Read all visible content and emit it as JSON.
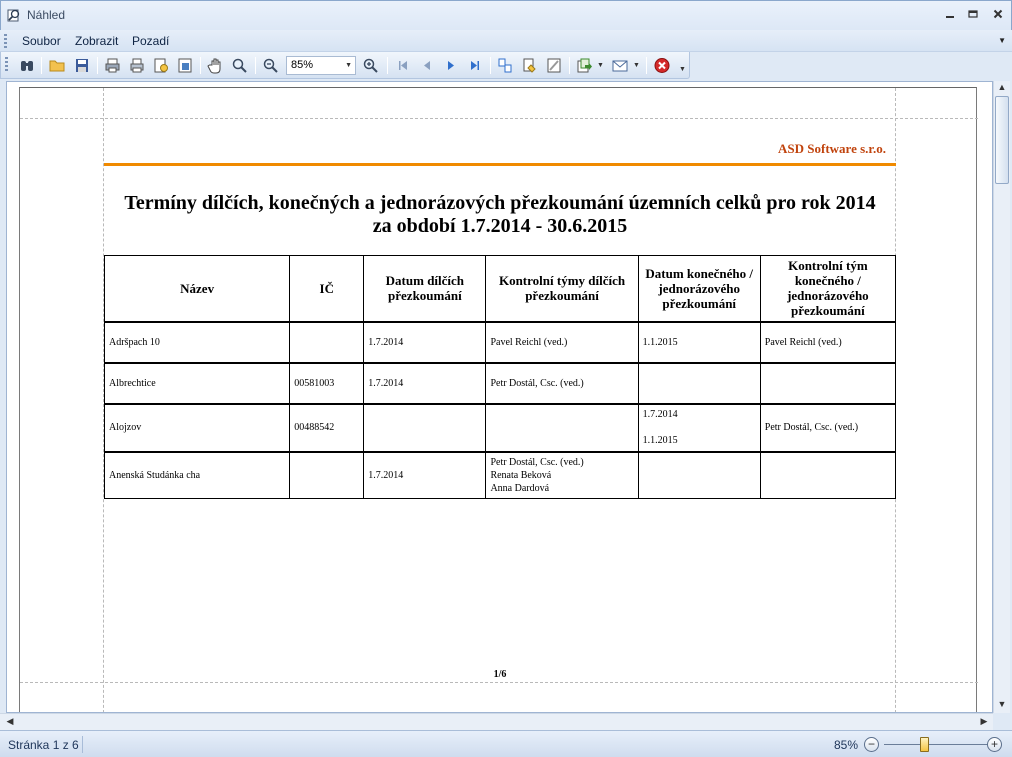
{
  "window": {
    "title": "Náhled"
  },
  "menu": {
    "items": [
      "Soubor",
      "Zobrazit",
      "Pozadí"
    ]
  },
  "toolbar": {
    "zoom_value": "85%"
  },
  "report": {
    "company": "ASD Software s.r.o.",
    "title_line1": "Termíny dílčích, konečných a jednorázových přezkoumání územních celků pro rok 2014",
    "title_line2": "za období 1.7.2014 - 30.6.2015",
    "headers": [
      "Název",
      "IČ",
      "Datum dílčích přezkoumání",
      "Kontrolní týmy dílčích přezkoumání",
      "Datum konečného / jednorázového přezkoumání",
      "Kontrolní tým konečného / jednorázového přezkoumání"
    ],
    "rows": [
      {
        "nazev": "Adršpach 10",
        "ic": "",
        "datum_dilci": "1.7.2014",
        "tymy_dilci": [
          "Pavel Reichl (ved.)"
        ],
        "datum_konecne": [
          "1.1.2015"
        ],
        "tym_konecny": "Pavel Reichl (ved.)"
      },
      {
        "nazev": "Albrechtice",
        "ic": "00581003",
        "datum_dilci": "1.7.2014",
        "tymy_dilci": [
          "Petr Dostál, Csc. (ved.)"
        ],
        "datum_konecne": [],
        "tym_konecny": ""
      },
      {
        "nazev": "Alojzov",
        "ic": "00488542",
        "datum_dilci": "",
        "tymy_dilci": [],
        "datum_konecne": [
          "1.7.2014",
          "1.1.2015"
        ],
        "tym_konecny": "Petr Dostál, Csc. (ved.)"
      },
      {
        "nazev": "Anenská Studánka cha",
        "ic": "",
        "datum_dilci": "1.7.2014",
        "tymy_dilci": [
          "Petr Dostál, Csc. (ved.)",
          "Renata Beková",
          "Anna Dardová"
        ],
        "datum_konecne": [],
        "tym_konecny": ""
      }
    ],
    "page_number": "1/6"
  },
  "status": {
    "page_text": "Stránka 1 z 6",
    "zoom": "85%"
  }
}
